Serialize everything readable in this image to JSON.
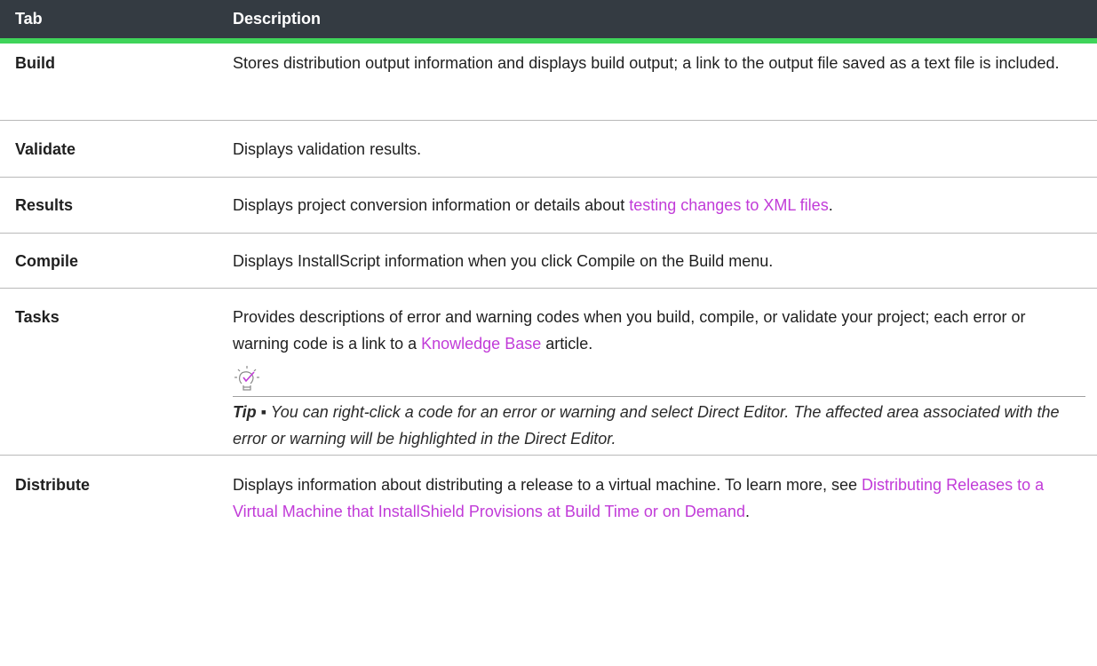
{
  "header": {
    "col1": "Tab",
    "col2": "Description"
  },
  "rows": [
    {
      "tab": "Build",
      "desc": "Stores distribution output information and displays build output; a link to the output file saved as a text file is included."
    },
    {
      "tab": "Validate",
      "desc": "Displays validation results."
    },
    {
      "tab": "Results",
      "desc_before": "Displays project conversion information or details about ",
      "link": "testing changes to XML files",
      "desc_after": "."
    },
    {
      "tab": "Compile",
      "desc": "Displays InstallScript information when you click Compile on the Build menu."
    },
    {
      "tab": "Tasks",
      "desc_before": "Provides descriptions of error and warning codes when you build, compile, or validate your project; each error or warning code is a link to a ",
      "link": "Knowledge Base",
      "desc_after": " article.",
      "tip_label": "Tip ▪",
      "tip_text": " You can right-click a code for an error or warning and select Direct Editor. The affected area associated with the error or warning will be highlighted in the Direct Editor.",
      "tip_icon": "lightbulb-check-icon"
    },
    {
      "tab": "Distribute",
      "desc_before": "Displays information about distributing a release to a virtual machine. To learn more, see ",
      "link": "Distributing Releases to a Virtual Machine that InstallShield Provisions at Build Time or on Demand",
      "desc_after": "."
    }
  ],
  "colors": {
    "header_bg": "#343b42",
    "header_rule": "#3fd45a",
    "link": "#c13bd8"
  }
}
